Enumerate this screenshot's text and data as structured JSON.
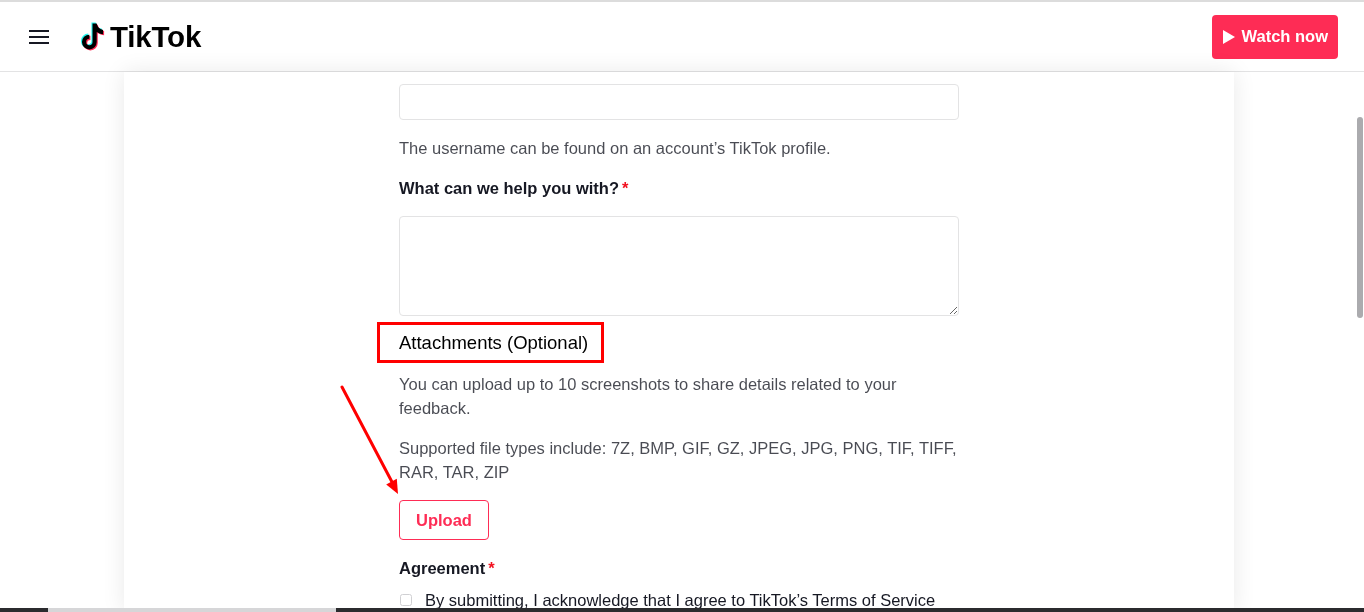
{
  "header": {
    "logo": {
      "text": "TikTok"
    },
    "watch_button": {
      "label": "Watch now"
    }
  },
  "form": {
    "sections": [
      {
        "kind": "input",
        "help": "The username can be found on an account’s TikTok profile."
      },
      {
        "kind": "textarea",
        "label": "What can we help you with?",
        "required_mark": "*"
      },
      {
        "kind": "attachments",
        "heading": "Attachments (Optional)",
        "highlighted": true,
        "paragraphs": [
          "You can upload up to 10 screenshots to share details related to your feedback.",
          "Supported file types include: 7Z, BMP, GIF, GZ, JPEG, JPG, PNG, TIF, TIFF, RAR, TAR, ZIP"
        ],
        "button": {
          "label": "Upload",
          "pointed_at": true
        }
      },
      {
        "kind": "agreement",
        "label": "Agreement",
        "required_mark": "*",
        "checkbox": {
          "checked": false,
          "label": "By submitting, I acknowledge that I agree to TikTok’s Terms of Service"
        }
      }
    ]
  }
}
